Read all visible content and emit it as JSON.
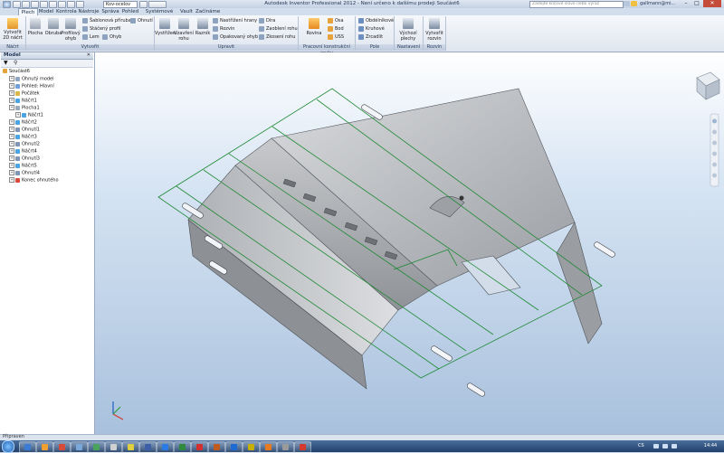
{
  "titlebar": {
    "document_combo": "Kov-ocelov",
    "title": "Autodesk Inventor Professional 2012 - Není určeno k dalšímu prodeji   Součást6",
    "search_placeholder": "Zadejte klíčové slovo nebo výraz",
    "user": "gallmann@mi...",
    "minimize": "–",
    "maximize": "□",
    "close": "✕"
  },
  "tabs": [
    "Plech",
    "Model",
    "Kontrola",
    "Nástroje",
    "Správa",
    "Pohled",
    "Systémové prostředí",
    "Vault",
    "Začínáme"
  ],
  "active_tab": "Plech",
  "ribbon": {
    "nacrt": {
      "label": "Náčrt",
      "create_2d": "Vytvořit 2D náčrt"
    },
    "vytvorit": {
      "label": "Vytvořit",
      "plocha": "Plocha",
      "obruba": "Obruba",
      "profilovy_ohyb": "Profilový ohyb",
      "sablonova_prruba": "Šablonová příruba",
      "staceny_profil": "Stáčený profil",
      "lem": "Lem",
      "ohyb": "Ohyb",
      "ohnuti": "Ohnutí"
    },
    "upravit": {
      "label": "Upravit",
      "vystrizeni": "Vystřižení",
      "uzavreni_rohu": "Uzavření rohu",
      "razník": "Razník",
      "nastrizeni_hrany": "Nastřižení hrany",
      "rozvin": "Rozvin",
      "opakovany_ohyb": "Opakovaný ohyb",
      "dira": "Díra",
      "zaobleni_rohu": "Zaoblení rohu",
      "zkoseni_rohu": "Zkosení rohu"
    },
    "pracovni": {
      "label": "Pracovní konstrukční prvky",
      "rovina": "Rovina",
      "osa": "Osa",
      "bod": "Bod",
      "usS": "USS"
    },
    "pole": {
      "label": "Pole",
      "obdelnikove": "Obdélníkové",
      "kruhove": "Kruhové",
      "zrcadlit": "Zrcadlit"
    },
    "nastaveni": {
      "label": "Nastavení",
      "vychozi_plechy": "Výchozí plechy"
    },
    "rozvin": {
      "label": "Rozvin",
      "vytvorit_rozvin": "Vytvořit rozvin"
    }
  },
  "browser": {
    "header": "Model",
    "tree": [
      {
        "label": "Součást6",
        "indent": 0,
        "icon": "part-icon"
      },
      {
        "label": "Ohnutý model",
        "indent": 1,
        "icon": "folder-icon"
      },
      {
        "label": "Pohled: Hlavní",
        "indent": 1,
        "icon": "view-icon"
      },
      {
        "label": "Počátek",
        "indent": 1,
        "icon": "origin-icon"
      },
      {
        "label": "Náčrt1",
        "indent": 1,
        "icon": "sketch-icon"
      },
      {
        "label": "Plocha1",
        "indent": 1,
        "icon": "face-icon"
      },
      {
        "label": "Náčrt1",
        "indent": 2,
        "icon": "sketch-icon"
      },
      {
        "label": "Náčrt2",
        "indent": 1,
        "icon": "sketch-icon"
      },
      {
        "label": "Ohnutí1",
        "indent": 1,
        "icon": "fold-icon"
      },
      {
        "label": "Náčrt3",
        "indent": 1,
        "icon": "sketch-icon"
      },
      {
        "label": "Ohnutí2",
        "indent": 1,
        "icon": "fold-icon"
      },
      {
        "label": "Náčrt4",
        "indent": 1,
        "icon": "sketch-icon"
      },
      {
        "label": "Ohnutí3",
        "indent": 1,
        "icon": "fold-icon"
      },
      {
        "label": "Náčrt5",
        "indent": 1,
        "icon": "sketch-icon"
      },
      {
        "label": "Ohnutí4",
        "indent": 1,
        "icon": "fold-icon"
      },
      {
        "label": "Konec ohnutého",
        "indent": 1,
        "icon": "end-icon"
      }
    ]
  },
  "status": {
    "text": "Připraven"
  },
  "taskbar": {
    "lang": "CS",
    "clock": "14:44"
  },
  "colors": {
    "sketch": "#1f8a36",
    "metal_light": "#d7d9dc",
    "metal_dark": "#8d9095"
  }
}
